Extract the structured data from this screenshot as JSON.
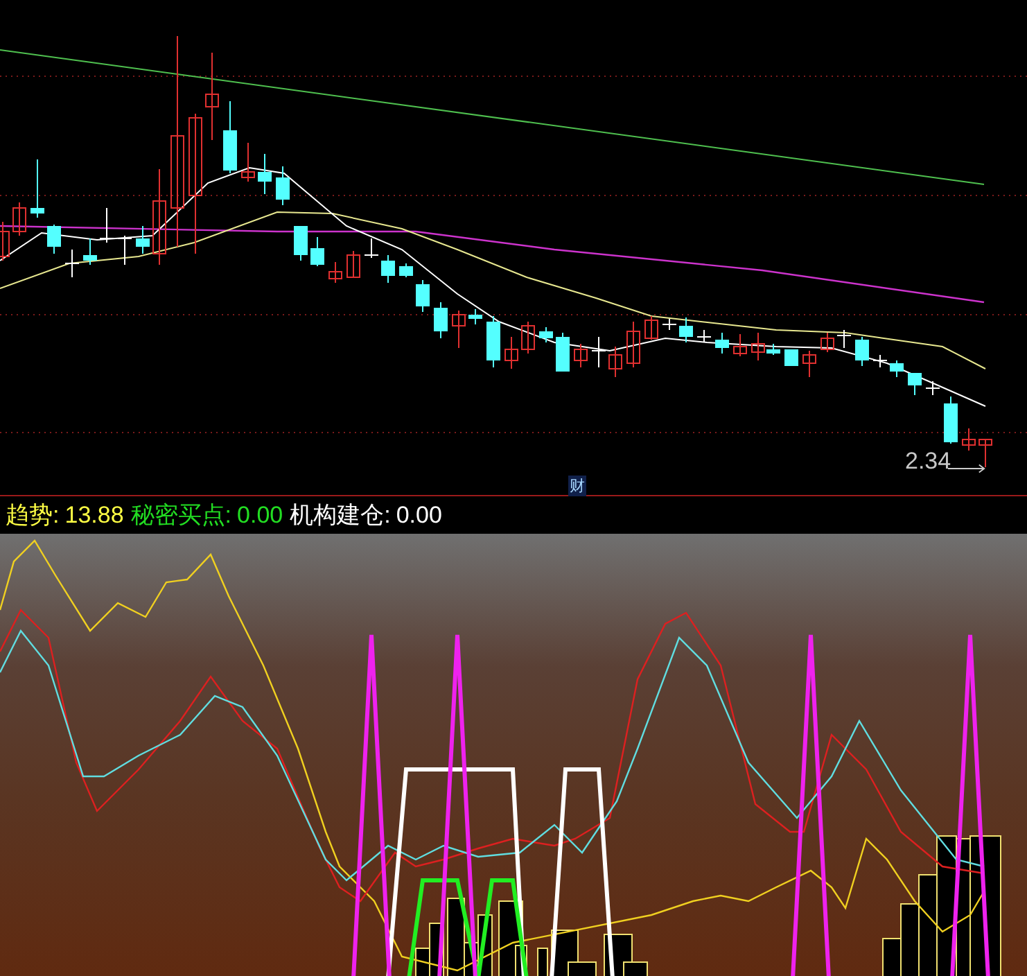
{
  "price_panel": {
    "last_price_label": "2.34",
    "finance_marker": "财"
  },
  "indicator_header": [
    {
      "label": "趋势:",
      "value": "13.88",
      "color": "#ffff44"
    },
    {
      "label": "秘密买点:",
      "value": "0.00",
      "color": "#22dd22"
    },
    {
      "label": "机构建仓:",
      "value": "0.00",
      "color": "#ffffff"
    }
  ]
}
